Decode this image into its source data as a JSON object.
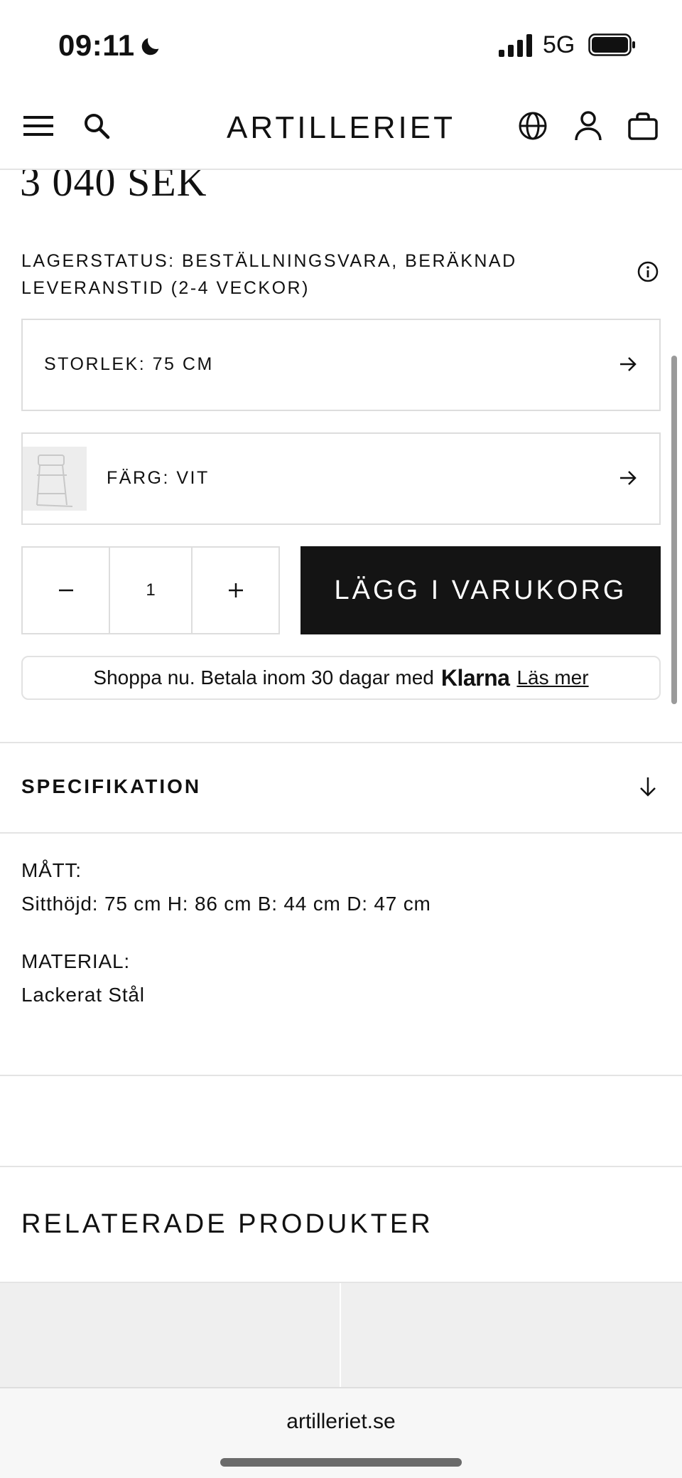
{
  "status_bar": {
    "time": "09:11",
    "network": "5G"
  },
  "header": {
    "logo": "ARTILLERIET"
  },
  "product": {
    "price": "3 040 SEK",
    "stock_status": "LAGERSTATUS: BESTÄLLNINGSVARA, BERÄKNAD LEVERANSTID (2-4 VECKOR)",
    "size_option": "STORLEK: 75 CM",
    "color_option": "FÄRG: VIT",
    "quantity": "1",
    "add_to_cart": "LÄGG I VARUKORG"
  },
  "klarna": {
    "text": "Shoppa nu. Betala inom 30 dagar med",
    "brand": "Klarna",
    "link": "Läs mer"
  },
  "specification": {
    "title": "SPECIFIKATION",
    "dimensions_label": "MÅTT:",
    "dimensions_value": "Sitthöjd: 75 cm H: 86 cm B: 44 cm D: 47 cm",
    "material_label": "MATERIAL:",
    "material_value": "Lackerat Stål"
  },
  "related": {
    "title": "RELATERADE PRODUKTER"
  },
  "browser": {
    "url": "artilleriet.se"
  }
}
